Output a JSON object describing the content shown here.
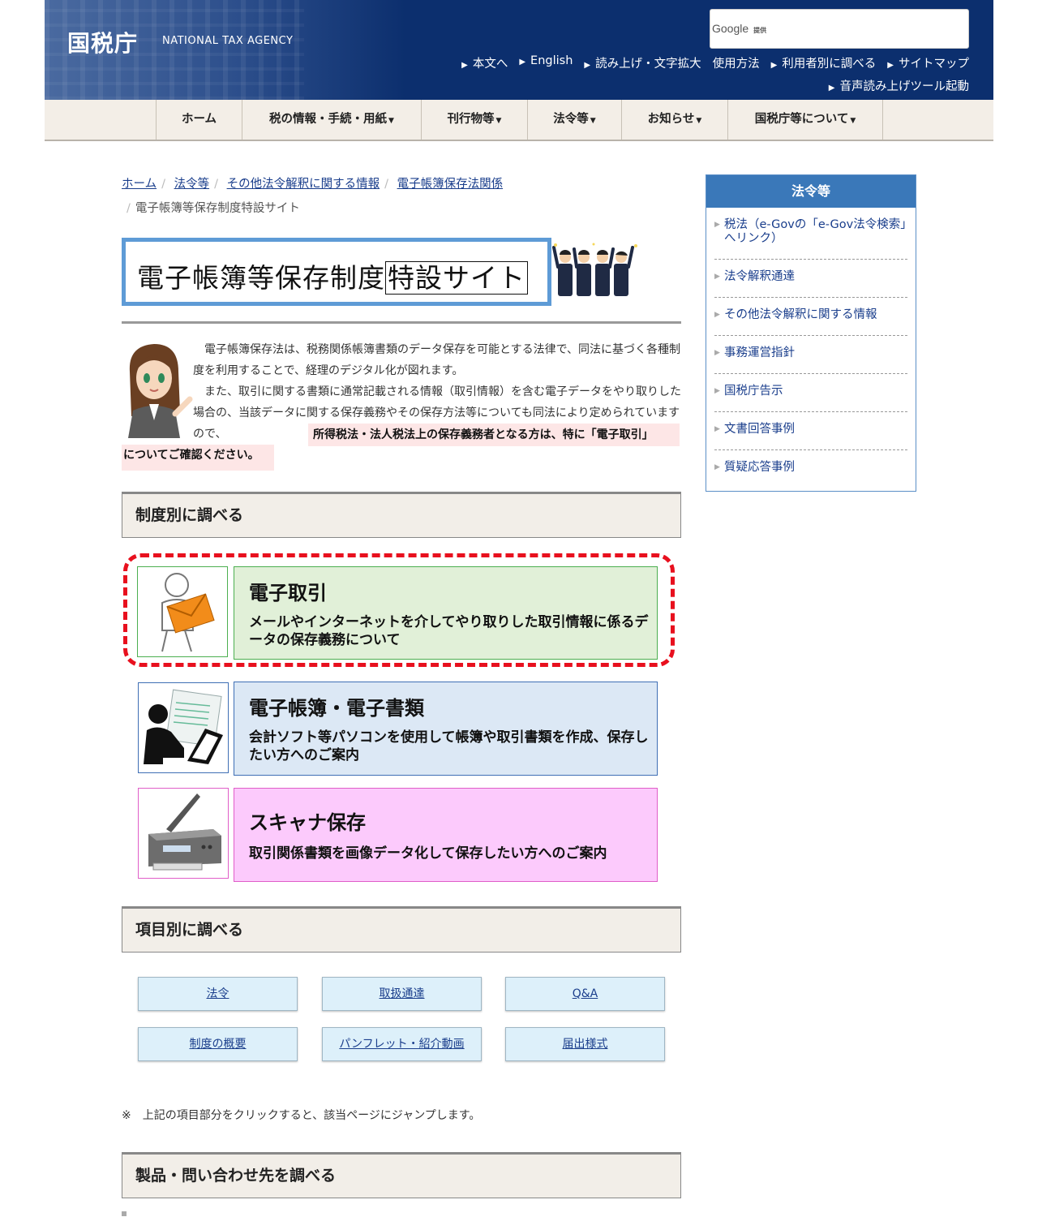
{
  "header": {
    "logo_jp": "国税庁",
    "logo_en": "NATIONAL TAX AGENCY",
    "search_brand": "Google",
    "search_suffix": "提供",
    "links": [
      "本文へ",
      "English",
      "読み上げ・文字拡大",
      "使用方法",
      "利用者別に調べる",
      "サイトマップ"
    ],
    "voice_link": "音声読み上げツール起動"
  },
  "gnav": [
    "ホーム",
    "税の情報・手続・用紙",
    "刊行物等",
    "法令等",
    "お知らせ",
    "国税庁等について"
  ],
  "breadcrumb": {
    "links": [
      "ホーム",
      "法令等",
      "その他法令解釈に関する情報",
      "電子帳簿保存法関係"
    ],
    "current": "電子帳簿等保存制度特設サイト"
  },
  "banner": {
    "title_a": "電子帳簿等保存制度",
    "title_b": "特設サイト"
  },
  "intro": {
    "p1": "電子帳簿保存法は、税務関係帳簿書類のデータ保存を可能とする法律で、同法に基づく各種制度を利用することで、経理のデジタル化が図れます。",
    "p2": "また、取引に関する書類に通常記載される情報（取引情報）を含む電子データをやり取りした場合の、当該データに関する保存義務やその保存方法等についても同法により定められていますので、",
    "highlight_1": "所得税法・法人税法上の保存義務者となる方は、特に「電子取引」",
    "highlight_2": "についてご確認ください。"
  },
  "sections": {
    "by_system": "制度別に調べる",
    "by_item": "項目別に調べる",
    "by_product": "製品・問い合わせ先を調べる"
  },
  "cards": [
    {
      "title": "電子取引",
      "desc": "メールやインターネットを介してやり取りした取引情報に係るデータの保存義務について",
      "color": "#e1f0d8",
      "border": "#4caf50"
    },
    {
      "title": "電子帳簿・電子書類",
      "desc": "会計ソフト等パソコンを使用して帳簿や取引書類を作成、保存したい方へのご案内",
      "color": "#dce8f5",
      "border": "#3f6fb5"
    },
    {
      "title": "スキャナ保存",
      "desc": "取引関係書類を画像データ化して保存したい方へのご案内",
      "color": "#fccafc",
      "border": "#e05ec8"
    }
  ],
  "item_buttons": [
    "法令",
    "取扱通達",
    "Q&A",
    "制度の概要",
    "パンフレット・紹介動画",
    "届出様式"
  ],
  "note": "※　上記の項目部分をクリックすると、該当ページにジャンプします。",
  "sidebar": {
    "title": "法令等",
    "items": [
      "税法（e-Govの「e-Gov法令検索」へリンク）",
      "法令解釈通達",
      "その他法令解釈に関する情報",
      "事務運営指針",
      "国税庁告示",
      "文書回答事例",
      "質疑応答事例"
    ]
  },
  "colors": {
    "header_bg": "#0c2f6e",
    "nav_bg": "#f3eee7",
    "accent": "#3a78b9",
    "dashed_border": "#e8101e"
  }
}
